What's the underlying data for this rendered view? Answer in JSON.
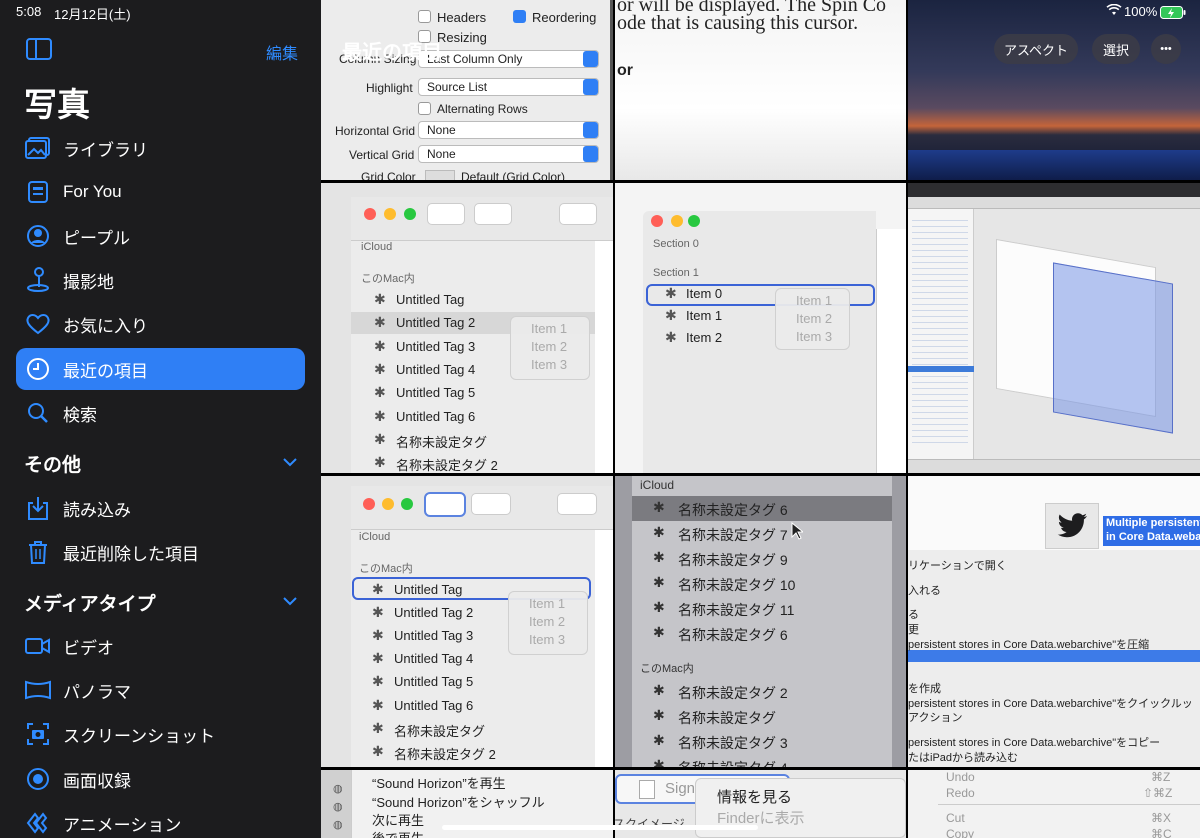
{
  "status": {
    "time": "5:08",
    "date": "12月12日(土)",
    "battery": "100%"
  },
  "sidebar": {
    "edit_label": "編集",
    "title": "写真",
    "items": [
      {
        "label": "ライブラリ",
        "icon": "photo-library-icon"
      },
      {
        "label": "For You",
        "icon": "for-you-icon"
      },
      {
        "label": "ピープル",
        "icon": "people-icon"
      },
      {
        "label": "撮影地",
        "icon": "map-pin-icon"
      },
      {
        "label": "お気に入り",
        "icon": "heart-icon"
      },
      {
        "label": "最近の項目",
        "icon": "clock-icon",
        "active": true
      },
      {
        "label": "検索",
        "icon": "search-icon"
      }
    ],
    "section_other": "その他",
    "other_items": [
      {
        "label": "読み込み",
        "icon": "import-icon"
      },
      {
        "label": "最近削除した項目",
        "icon": "trash-icon"
      }
    ],
    "section_media": "メディアタイプ",
    "media_items": [
      {
        "label": "ビデオ",
        "icon": "video-icon"
      },
      {
        "label": "パノラマ",
        "icon": "panorama-icon"
      },
      {
        "label": "スクリーンショット",
        "icon": "screenshot-icon"
      },
      {
        "label": "画面収録",
        "icon": "screen-record-icon"
      },
      {
        "label": "アニメーション",
        "icon": "animation-icon"
      }
    ]
  },
  "header": {
    "title": "最近の項目",
    "aspect_label": "アスペクト",
    "select_label": "選択",
    "more_label": "•••"
  },
  "thumbs": {
    "t1": {
      "headers": "Headers",
      "reordering": "Reordering",
      "resizing": "Resizing",
      "column_sizing_label": "Column Sizing",
      "column_sizing_value": "Last Column Only",
      "highlight_label": "Highlight",
      "highlight_value": "Source List",
      "alternating_rows": "Alternating Rows",
      "hgrid_label": "Horizontal Grid",
      "hgrid_value": "None",
      "vgrid_label": "Vertical Grid",
      "vgrid_value": "None",
      "grid_color_label": "Grid Color",
      "grid_color_value": "Default (Grid Color)"
    },
    "t2": {
      "line1": "or will be displayed. The Spin Co",
      "line2": "ode that is causing this cursor.",
      "line3": "or"
    },
    "t4": {
      "icloud": "iCloud",
      "mac": "このMac内",
      "rows": [
        "Untitled Tag",
        "Untitled Tag 2",
        "Untitled Tag 3",
        "Untitled Tag 4",
        "Untitled Tag 5",
        "Untitled Tag 6",
        "名称未設定タグ",
        "名称未設定タグ 2"
      ],
      "menu": [
        "Item 1",
        "Item 2",
        "Item 3"
      ]
    },
    "t5": {
      "sec0": "Section 0",
      "sec1": "Section 1",
      "rows": [
        "Item 0",
        "Item 1",
        "Item 2"
      ],
      "menu": [
        "Item 1",
        "Item 2",
        "Item 3"
      ]
    },
    "t7": {
      "icloud": "iCloud",
      "mac": "このMac内",
      "rows": [
        "Untitled Tag",
        "Untitled Tag 2",
        "Untitled Tag 3",
        "Untitled Tag 4",
        "Untitled Tag 5",
        "Untitled Tag 6",
        "名称未設定タグ",
        "名称未設定タグ 2"
      ],
      "menu": [
        "Item 1",
        "Item 2",
        "Item 3"
      ]
    },
    "t8": {
      "icloud": "iCloud",
      "mac": "このMac内",
      "cloud_rows": [
        "名称未設定タグ 6",
        "名称未設定タグ 7",
        "名称未設定タグ 9",
        "名称未設定タグ 10",
        "名称未設定タグ 11",
        "名称未設定タグ 6"
      ],
      "mac_rows": [
        "名称未設定タグ 2",
        "名称未設定タグ",
        "名称未設定タグ 3",
        "名称未設定タグ 4"
      ]
    },
    "t9": {
      "title1": "Multiple persistent",
      "title2": "in Core Data.weba",
      "lines": [
        "リケーションで開く",
        "入れる",
        "る",
        "更",
        "persistent stores in Core Data.webarchive\"を圧縮",
        "",
        "を作成",
        "persistent stores in Core Data.webarchive\"をクイックルッ",
        "アクション",
        "persistent stores in Core Data.webarchive\"をコピー",
        "たはiPadから読み込む"
      ]
    },
    "t10": {
      "lines": [
        "“Sound Horizon”を再生",
        "“Sound Horizon”をシャッフル",
        "次に再生",
        "後で再生"
      ]
    },
    "t11": {
      "sign": "Sign",
      "info": "情報を見る",
      "finder": "Finderに表示",
      "sukai": "スクイメージ"
    },
    "t12": {
      "undo": "Undo",
      "redo": "Redo",
      "cut": "Cut",
      "copy": "Copy",
      "k_undo": "⌘Z",
      "k_redo": "⇧⌘Z",
      "k_cut": "⌘X",
      "k_copy": "⌘C"
    }
  },
  "colors": {
    "accent": "#2f7ff5",
    "sidebar_bg": "#1c1c1e",
    "selection_ring": "#3b63d6"
  }
}
